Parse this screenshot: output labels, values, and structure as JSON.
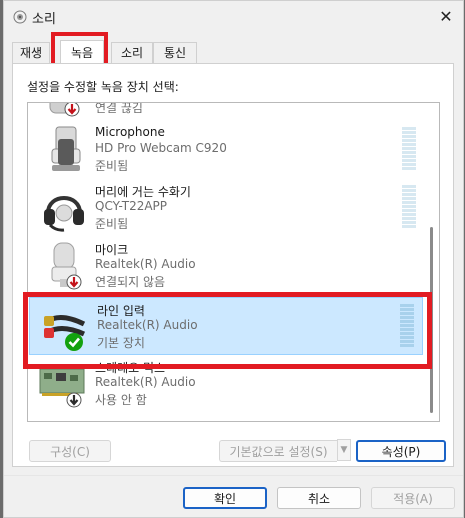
{
  "window": {
    "title": "소리",
    "close_glyph": "✕"
  },
  "tabs": [
    "재생",
    "녹음",
    "소리",
    "통신"
  ],
  "active_tab": "녹음",
  "instruction": "설정을 수정할 녹음 장치 선택:",
  "devices": [
    {
      "name": "",
      "sub": "",
      "status": "연결 끊김",
      "icon": "partial-device-icon"
    },
    {
      "name": "Microphone",
      "sub": "HD Pro Webcam C920",
      "status": "준비됨",
      "icon": "microphone-icon"
    },
    {
      "name": "머리에 거는 수화기",
      "sub": "QCY-T22APP",
      "status": "준비됨",
      "icon": "headset-icon"
    },
    {
      "name": "마이크",
      "sub": "Realtek(R) Audio",
      "status": "연결되지 않음",
      "icon": "microphone-icon"
    },
    {
      "name": "라인 입력",
      "sub": "Realtek(R) Audio",
      "status": "기본 장치",
      "icon": "line-in-cable-icon",
      "selected": true
    },
    {
      "name": "스테레오 믹스",
      "sub": "Realtek(R) Audio",
      "status": "사용 안 함",
      "icon": "sound-card-icon"
    }
  ],
  "buttons": {
    "configure": "구성(C)",
    "set_default": "기본값으로 설정(S)",
    "properties": "속성(P)",
    "ok": "확인",
    "cancel": "취소",
    "apply": "적용(A)"
  },
  "colors": {
    "highlight": "#e21b22",
    "selection": "#cce8ff",
    "default_check": "#13a10e",
    "disabled_arrow": "#c4121a"
  }
}
